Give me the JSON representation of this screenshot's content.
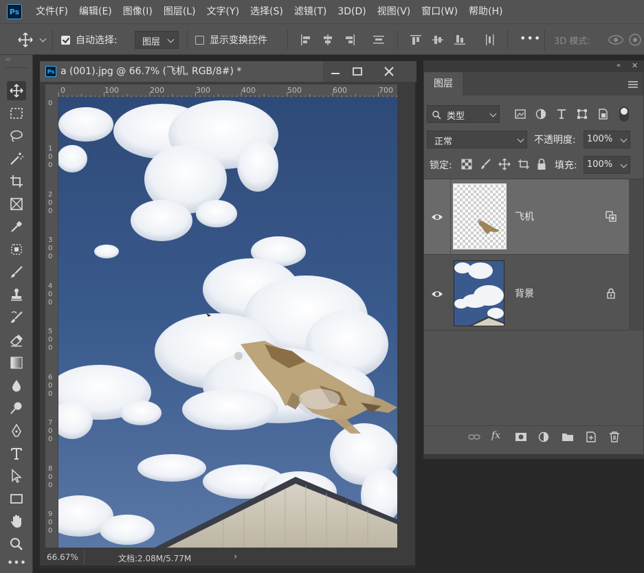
{
  "app": {
    "logo_text": "Ps"
  },
  "menu": [
    "文件(F)",
    "编辑(E)",
    "图像(I)",
    "图层(L)",
    "文字(Y)",
    "选择(S)",
    "滤镜(T)",
    "3D(D)",
    "视图(V)",
    "窗口(W)",
    "帮助(H)"
  ],
  "options": {
    "auto_select_label": "自动选择:",
    "auto_select_checked": true,
    "auto_select_target": "图层",
    "show_transform_label": "显示变换控件",
    "show_transform_checked": false,
    "more_label": "•••",
    "mode_3d_label": "3D 模式:"
  },
  "document": {
    "tab_icon": "Ps",
    "title": "a (001).jpg @ 66.7% (飞机, RGB/8#) *",
    "zoom": "66.67%",
    "doc_info": "文档:2.08M/5.77M",
    "ruler_top": [
      "0",
      "100",
      "200",
      "300",
      "400",
      "500",
      "600",
      "700"
    ],
    "ruler_left": [
      "0",
      "1\n0\n0",
      "2\n0\n0",
      "3\n0\n0",
      "4\n0\n0",
      "5\n0\n0",
      "6\n0\n0",
      "7\n0\n0",
      "8\n0\n0",
      "9\n0\n0"
    ]
  },
  "layers_panel": {
    "tab": "图层",
    "filter_kind": "类型",
    "blend_mode": "正常",
    "opacity_label": "不透明度:",
    "opacity_value": "100%",
    "lock_label": "锁定:",
    "fill_label": "填充:",
    "fill_value": "100%",
    "layers": [
      {
        "name": "飞机",
        "visible": true,
        "selected": true,
        "badge": "smart-object-icon"
      },
      {
        "name": "背景",
        "visible": true,
        "selected": false,
        "badge": "lock-icon"
      }
    ]
  },
  "colors": {
    "ui_bg": "#535353",
    "workspace": "#282828",
    "accent": "#31a8ff",
    "sky": "#345283"
  }
}
